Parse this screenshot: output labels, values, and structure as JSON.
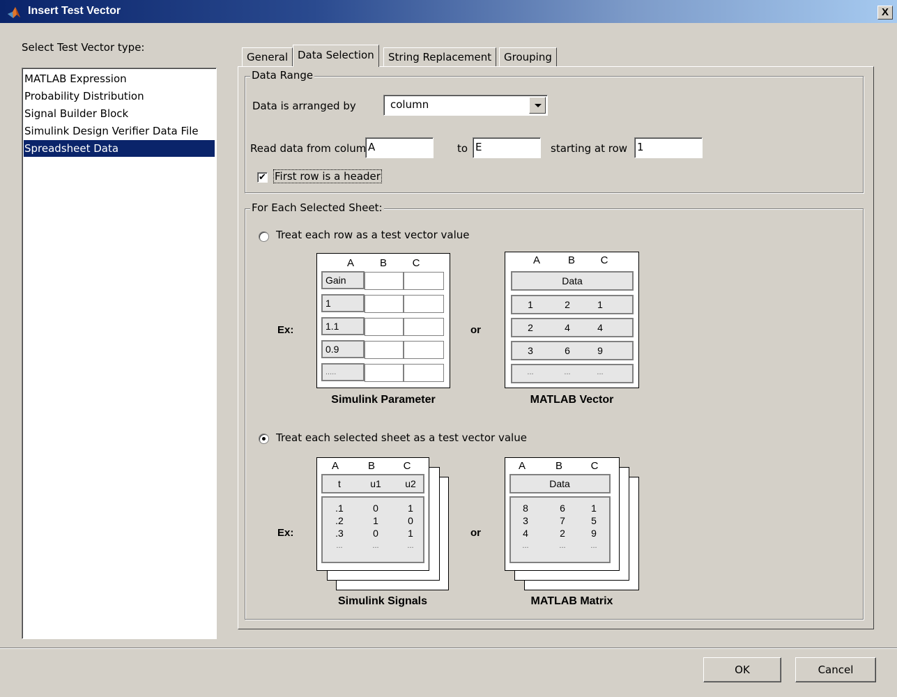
{
  "window": {
    "title": "Insert Test Vector",
    "close_label": "X"
  },
  "left": {
    "label": "Select Test Vector type:",
    "items": [
      "MATLAB Expression",
      "Probability Distribution",
      "Signal Builder Block",
      "Simulink Design Verifier Data File",
      "Spreadsheet Data"
    ],
    "selected": "Spreadsheet Data"
  },
  "tabs": [
    {
      "label": "General"
    },
    {
      "label": "Data Selection"
    },
    {
      "label": "String Replacement"
    },
    {
      "label": "Grouping"
    }
  ],
  "active_tab": "Data Selection",
  "data_range": {
    "title": "Data Range",
    "arranged_label": "Data is arranged by",
    "arranged_value": "column",
    "read_label": "Read data from column",
    "from_value": "A",
    "to_label": "to",
    "to_value": "E",
    "row_label": "starting at row",
    "row_value": "1",
    "header_checkbox_label": "First row is a header",
    "header_checked": true
  },
  "each_sheet": {
    "title": "For Each Selected Sheet:",
    "option_row": {
      "label": "Treat each row as a test vector value",
      "selected": false
    },
    "option_sheet": {
      "label": "Treat each selected sheet as a test vector value",
      "selected": true
    },
    "ex_label": "Ex:",
    "or_label": "or",
    "col_headers": [
      "A",
      "B",
      "C"
    ],
    "param": {
      "caption": "Simulink Parameter",
      "header": "Gain",
      "values": [
        "1",
        "1.1",
        "0.9",
        "....."
      ]
    },
    "vector": {
      "caption": "MATLAB Vector",
      "header": "Data",
      "rows": [
        [
          "1",
          "2",
          "1"
        ],
        [
          "2",
          "4",
          "4"
        ],
        [
          "3",
          "6",
          "9"
        ],
        [
          "...",
          "...",
          "..."
        ]
      ]
    },
    "signals": {
      "caption": "Simulink Signals",
      "headers": [
        "t",
        "u1",
        "u2"
      ],
      "rows": [
        [
          ".1",
          "0",
          "1"
        ],
        [
          ".2",
          "1",
          "0"
        ],
        [
          ".3",
          "0",
          "1"
        ],
        [
          "...",
          "...",
          "..."
        ]
      ]
    },
    "matrix": {
      "caption": "MATLAB Matrix",
      "header": "Data",
      "rows": [
        [
          "8",
          "6",
          "1"
        ],
        [
          "3",
          "7",
          "5"
        ],
        [
          "4",
          "2",
          "9"
        ],
        [
          "...",
          "...",
          "..."
        ]
      ]
    }
  },
  "buttons": {
    "ok": "OK",
    "cancel": "Cancel"
  },
  "colors": {
    "face": "#d4d0c8",
    "selection": "#0a246a",
    "title_start": "#0a246a",
    "title_end": "#a6caf0"
  }
}
